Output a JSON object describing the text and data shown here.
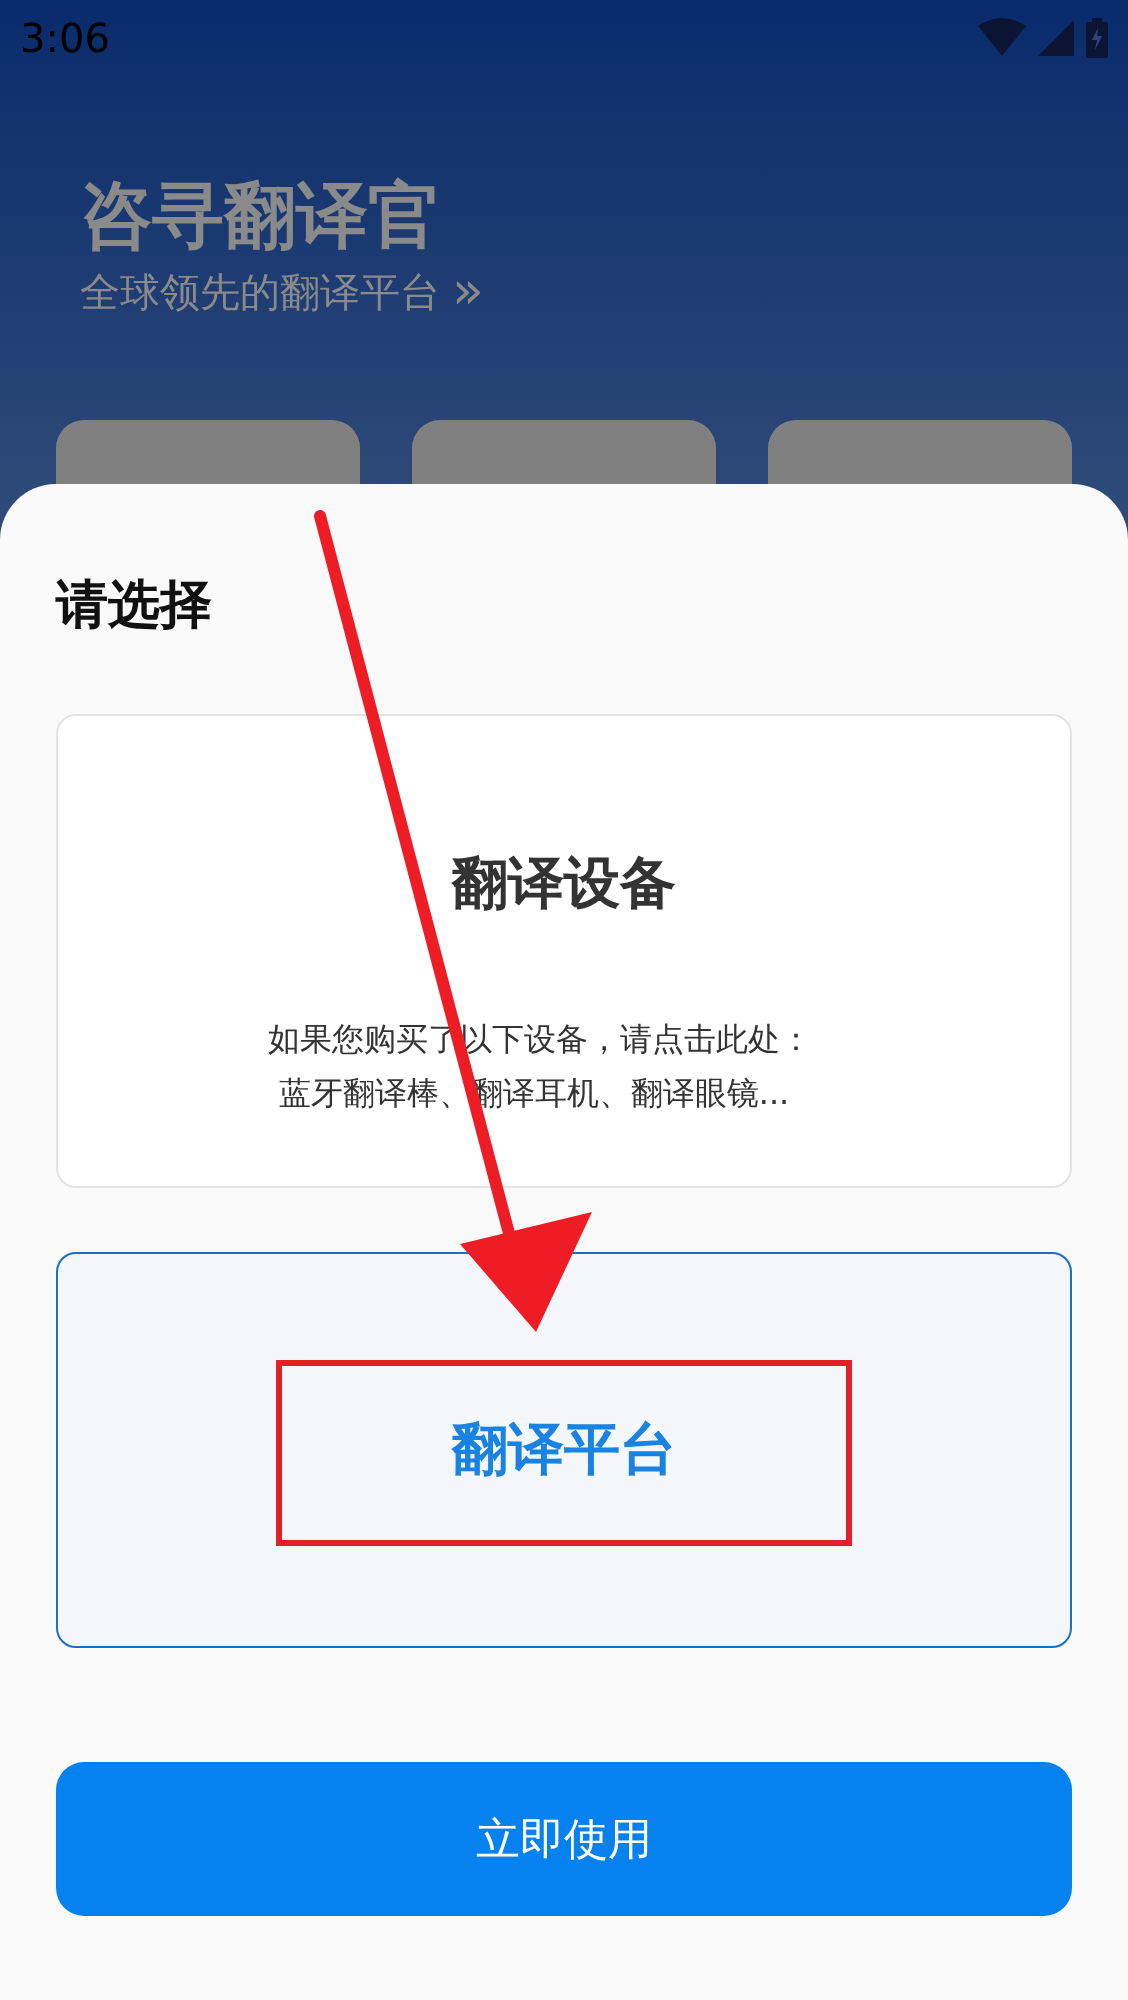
{
  "status_bar": {
    "time": "3:06"
  },
  "header": {
    "title": "咨寻翻译官",
    "subtitle": "全球领先的翻译平台",
    "subtitle_icon": "»"
  },
  "sheet": {
    "title": "请选择",
    "options": [
      {
        "title": "翻译设备",
        "description": [
          "如果您购买了以下设备，请点击此处：",
          "蓝牙翻译棒、翻译耳机、翻译眼镜..."
        ],
        "selected": false
      },
      {
        "title": "翻译平台",
        "selected": true
      }
    ],
    "button": "立即使用"
  }
}
